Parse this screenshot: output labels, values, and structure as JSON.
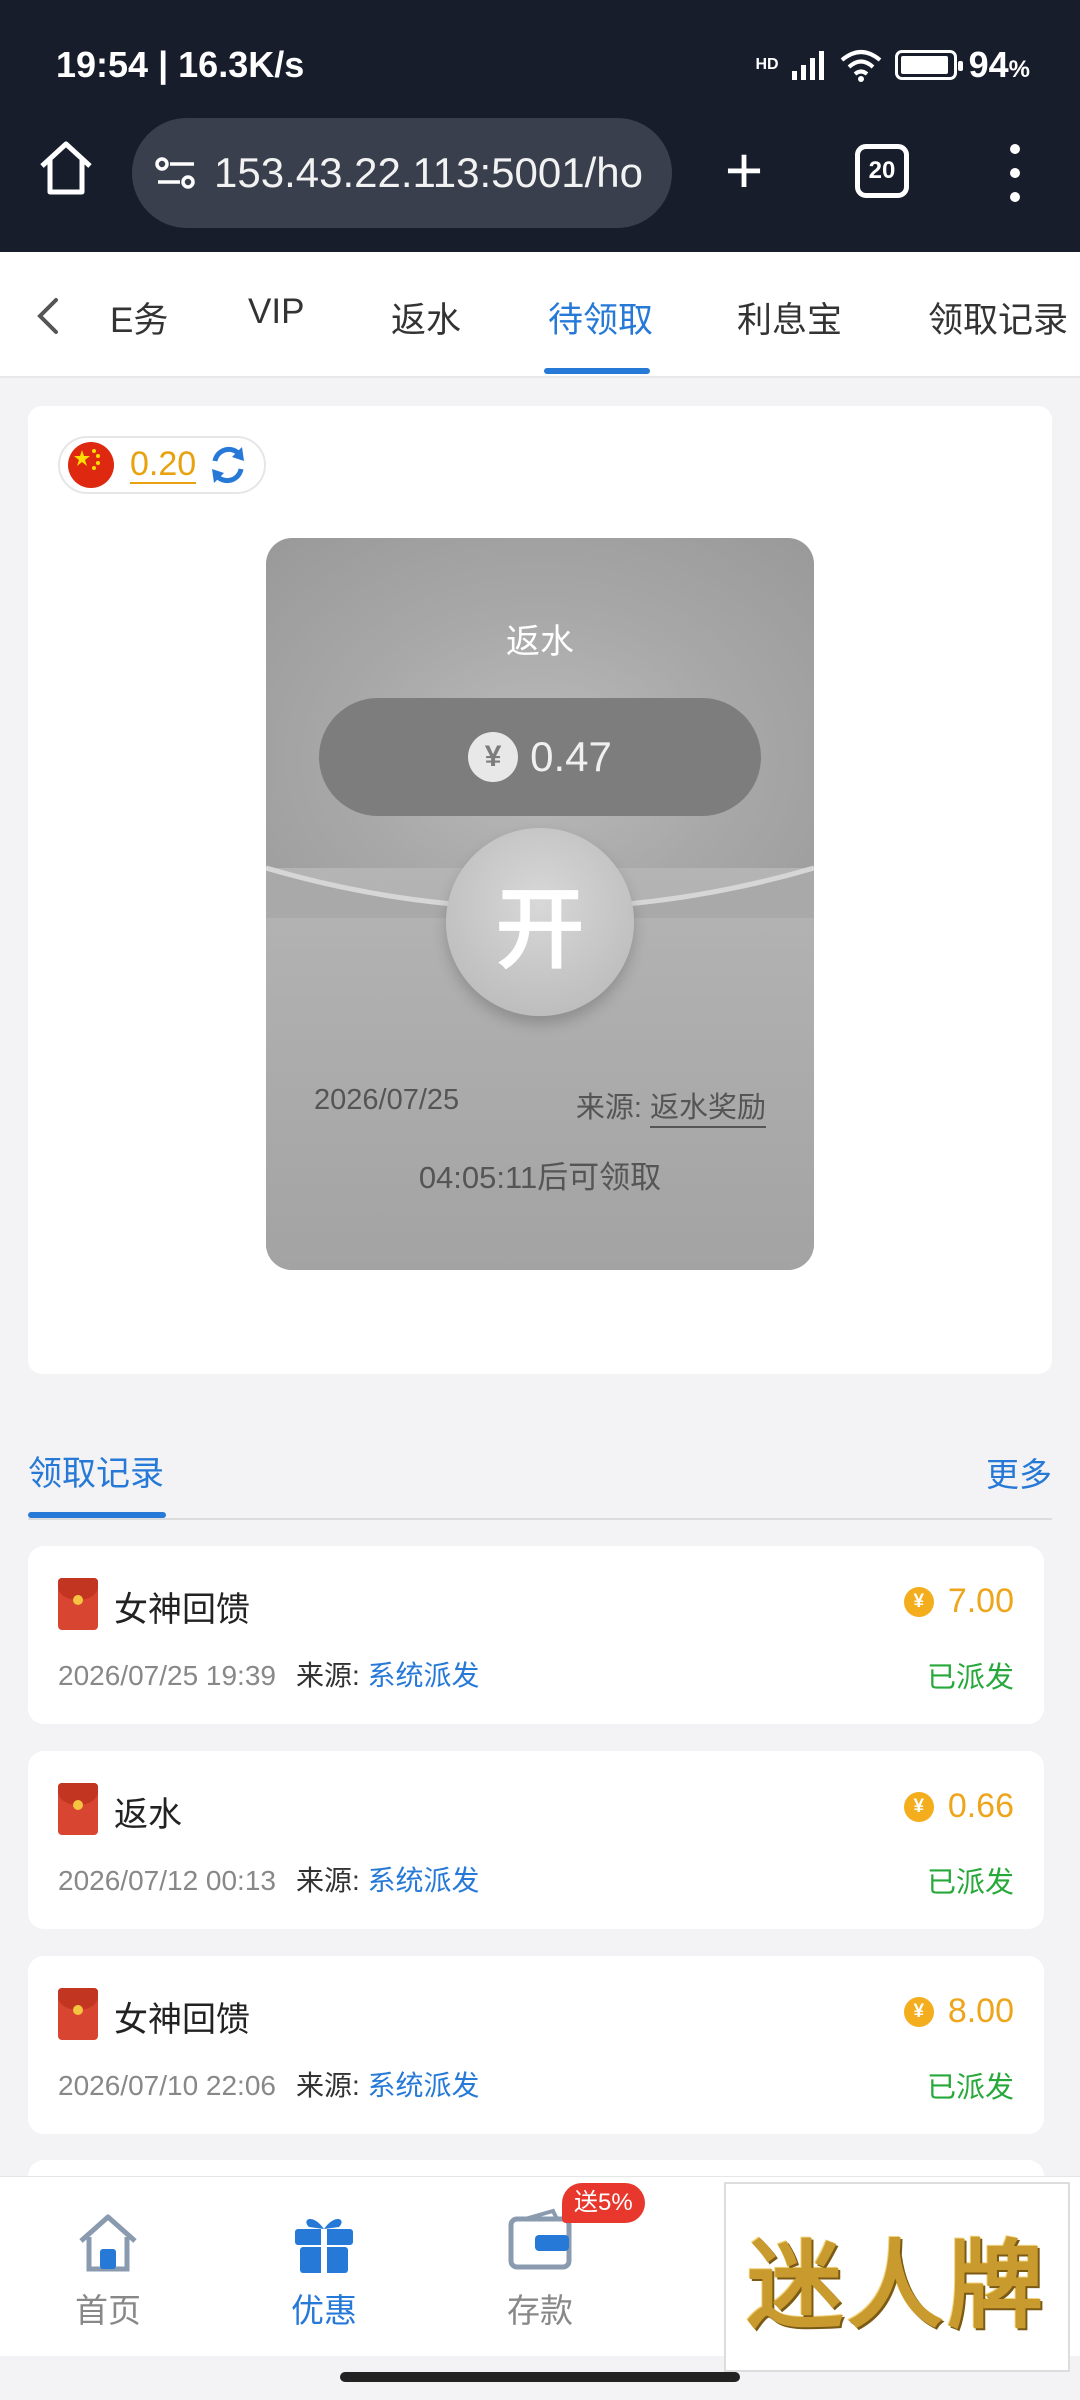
{
  "status_bar": {
    "time_speed": "19:54 | 16.3K/s",
    "network": "HD",
    "battery_percent": "94",
    "battery_suffix": "%",
    "battery_level": 0.94
  },
  "browser": {
    "url": "153.43.22.113:5001/ho",
    "tab_count": "20"
  },
  "category_tabs": {
    "items": [
      "E务",
      "VIP",
      "返水",
      "待领取",
      "利息宝",
      "领取记录"
    ],
    "active_index": 3
  },
  "balance": {
    "value": "0.20"
  },
  "envelope": {
    "title": "返水",
    "currency_symbol": "¥",
    "amount": "0.47",
    "open_label": "开",
    "date": "2026/07/25",
    "source_label": "来源: ",
    "source_value": "返水奖励",
    "countdown": "04:05:11后可领取"
  },
  "records": {
    "title": "领取记录",
    "more": "更多",
    "source_label": "来源: ",
    "items": [
      {
        "name": "女神回馈",
        "amount": "7.00",
        "time": "2026/07/25 19:39",
        "source": "系统派发",
        "status": "已派发"
      },
      {
        "name": "返水",
        "amount": "0.66",
        "time": "2026/07/12 00:13",
        "source": "系统派发",
        "status": "已派发"
      },
      {
        "name": "女神回馈",
        "amount": "8.00",
        "time": "2026/07/10 22:06",
        "source": "系统派发",
        "status": "已派发"
      }
    ]
  },
  "bottom_nav": {
    "items": [
      {
        "label": "首页",
        "icon": "home-icon"
      },
      {
        "label": "优惠",
        "icon": "gift-icon"
      },
      {
        "label": "存款",
        "icon": "wallet-icon"
      }
    ],
    "active_index": 1,
    "deposit_badge": "送5%"
  },
  "brand": {
    "text": "迷人牌"
  },
  "colors": {
    "accent": "#2679d7",
    "gold": "#eea51c",
    "success": "#27a83a",
    "chrome_bg": "#181d2c"
  }
}
